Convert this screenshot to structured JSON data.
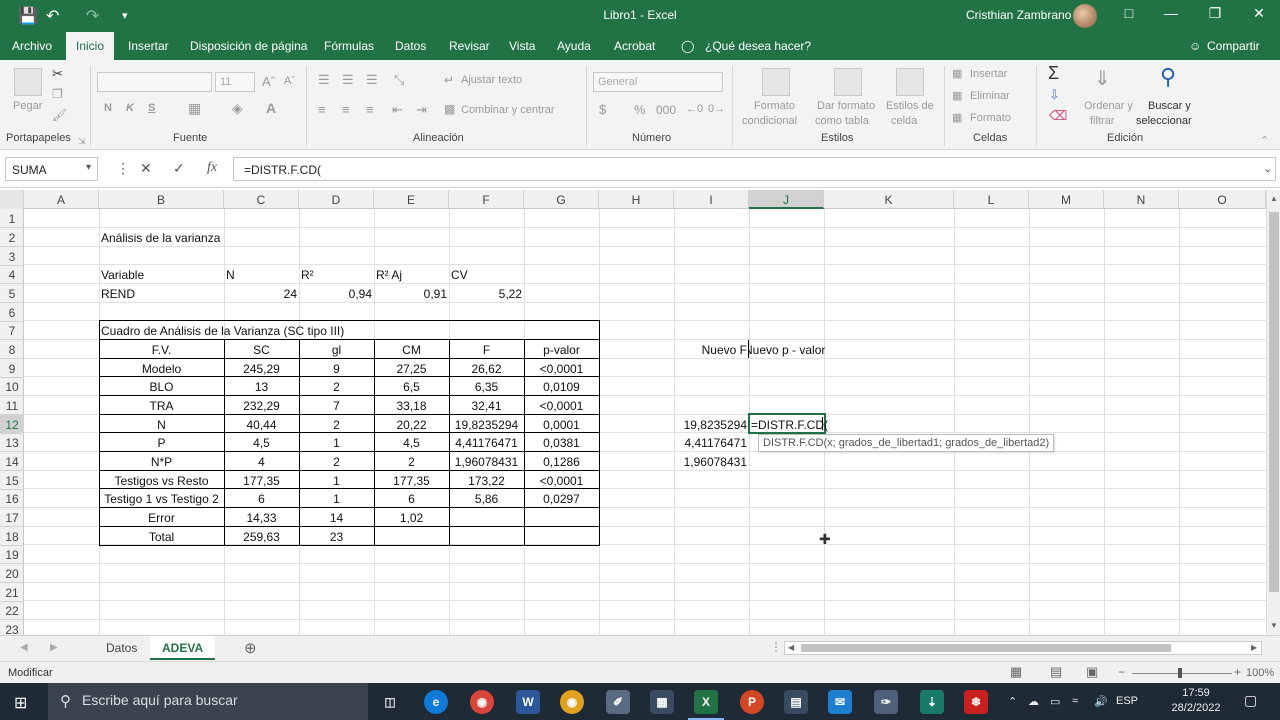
{
  "window": {
    "title": "Libro1  -  Excel",
    "user": "Cristhian Zambrano"
  },
  "menu": {
    "tabs": [
      "Archivo",
      "Inicio",
      "Insertar",
      "Disposición de página",
      "Fórmulas",
      "Datos",
      "Revisar",
      "Vista",
      "Ayuda",
      "Acrobat"
    ],
    "active_tab": "Inicio",
    "tell_me": "¿Qué desea hacer?",
    "share": "Compartir"
  },
  "ribbon": {
    "paste": "Pegar",
    "groups": {
      "clipboard": "Portapapeles",
      "font": "Fuente",
      "alignment": "Alineación",
      "number": "Número",
      "styles": "Estilos",
      "cells": "Celdas",
      "editing": "Edición"
    },
    "font_size": "11",
    "bold": "N",
    "italic": "K",
    "underline": "S",
    "wrap_text": "Ajustar texto",
    "merge_center": "Combinar y centrar",
    "number_format": "General",
    "currency": "$",
    "percent": "%",
    "thousands": "000",
    "conditional_format": [
      "Formato",
      "condicional"
    ],
    "format_table": [
      "Dar formato",
      "como tabla"
    ],
    "cell_styles": [
      "Estilos de",
      "celda"
    ],
    "insert": "Insertar",
    "delete": "Eliminar",
    "format": "Formato",
    "sort_filter": [
      "Ordenar y",
      "filtrar"
    ],
    "find_select": [
      "Buscar y",
      "seleccionar"
    ]
  },
  "formula_bar": {
    "name_box": "SUMA",
    "cancel": "✕",
    "enter": "✓",
    "fx": "fx",
    "formula": "=DISTR.F.CD("
  },
  "grid": {
    "columns": [
      "A",
      "B",
      "C",
      "D",
      "E",
      "F",
      "G",
      "H",
      "I",
      "J",
      "K",
      "L",
      "M",
      "N",
      "O"
    ],
    "selected_column": "J",
    "selected_row": "12",
    "rows": [
      "1",
      "2",
      "3",
      "4",
      "5",
      "6",
      "7",
      "8",
      "9",
      "10",
      "11",
      "12",
      "13",
      "14",
      "15",
      "16",
      "17",
      "18",
      "19",
      "20",
      "21",
      "22",
      "23"
    ],
    "title": "Análisis de la varianza",
    "summary": {
      "headers": [
        "Variable",
        "N",
        "R²",
        "R² Aj",
        "CV"
      ],
      "values": [
        "REND",
        "24",
        "0,94",
        "0,91",
        "5,22"
      ]
    },
    "anova": {
      "caption": "Cuadro de Análisis de la Varianza (SC tipo III)",
      "headers": [
        "F.V.",
        "SC",
        "gl",
        "CM",
        "F",
        "p-valor"
      ],
      "rows": [
        [
          "Modelo",
          "245,29",
          "9",
          "27,25",
          "26,62",
          "<0,0001"
        ],
        [
          "BLO",
          "13",
          "2",
          "6,5",
          "6,35",
          "0,0109"
        ],
        [
          "TRA",
          "232,29",
          "7",
          "33,18",
          "32,41",
          "<0,0001"
        ],
        [
          "N",
          "40,44",
          "2",
          "20,22",
          "19,8235294",
          "0,0001"
        ],
        [
          "P",
          "4,5",
          "1",
          "4,5",
          "4,41176471",
          "0,0381"
        ],
        [
          "N*P",
          "4",
          "2",
          "2",
          "1,96078431",
          "0,1286"
        ],
        [
          "Testigos vs Resto",
          "177,35",
          "1",
          "177,35",
          "173,22",
          "<0,0001"
        ],
        [
          "Testigo 1 vs Testigo 2",
          "6",
          "1",
          "6",
          "5,86",
          "0,0297"
        ],
        [
          "Error",
          "14,33",
          "14",
          "1,02",
          "",
          ""
        ],
        [
          "Total",
          "259,63",
          "23",
          "",
          "",
          ""
        ]
      ]
    },
    "new_f_header": "Nuevo F",
    "new_p_header": "Nuevo p - valor",
    "new_f_values": [
      "19,8235294",
      "4,41176471",
      "1,96078431"
    ],
    "editing_cell": "=DISTR.F.CD(",
    "tooltip": "DISTR.F.CD(x; grados_de_libertad1; grados_de_libertad2)"
  },
  "sheets": {
    "tabs": [
      "Datos",
      "ADEVA"
    ],
    "active": "ADEVA"
  },
  "status": {
    "mode": "Modificar",
    "zoom": "100%"
  },
  "taskbar": {
    "search_placeholder": "Escribe aquí para buscar",
    "language": "ESP",
    "time": "17:59",
    "date": "28/2/2022"
  }
}
